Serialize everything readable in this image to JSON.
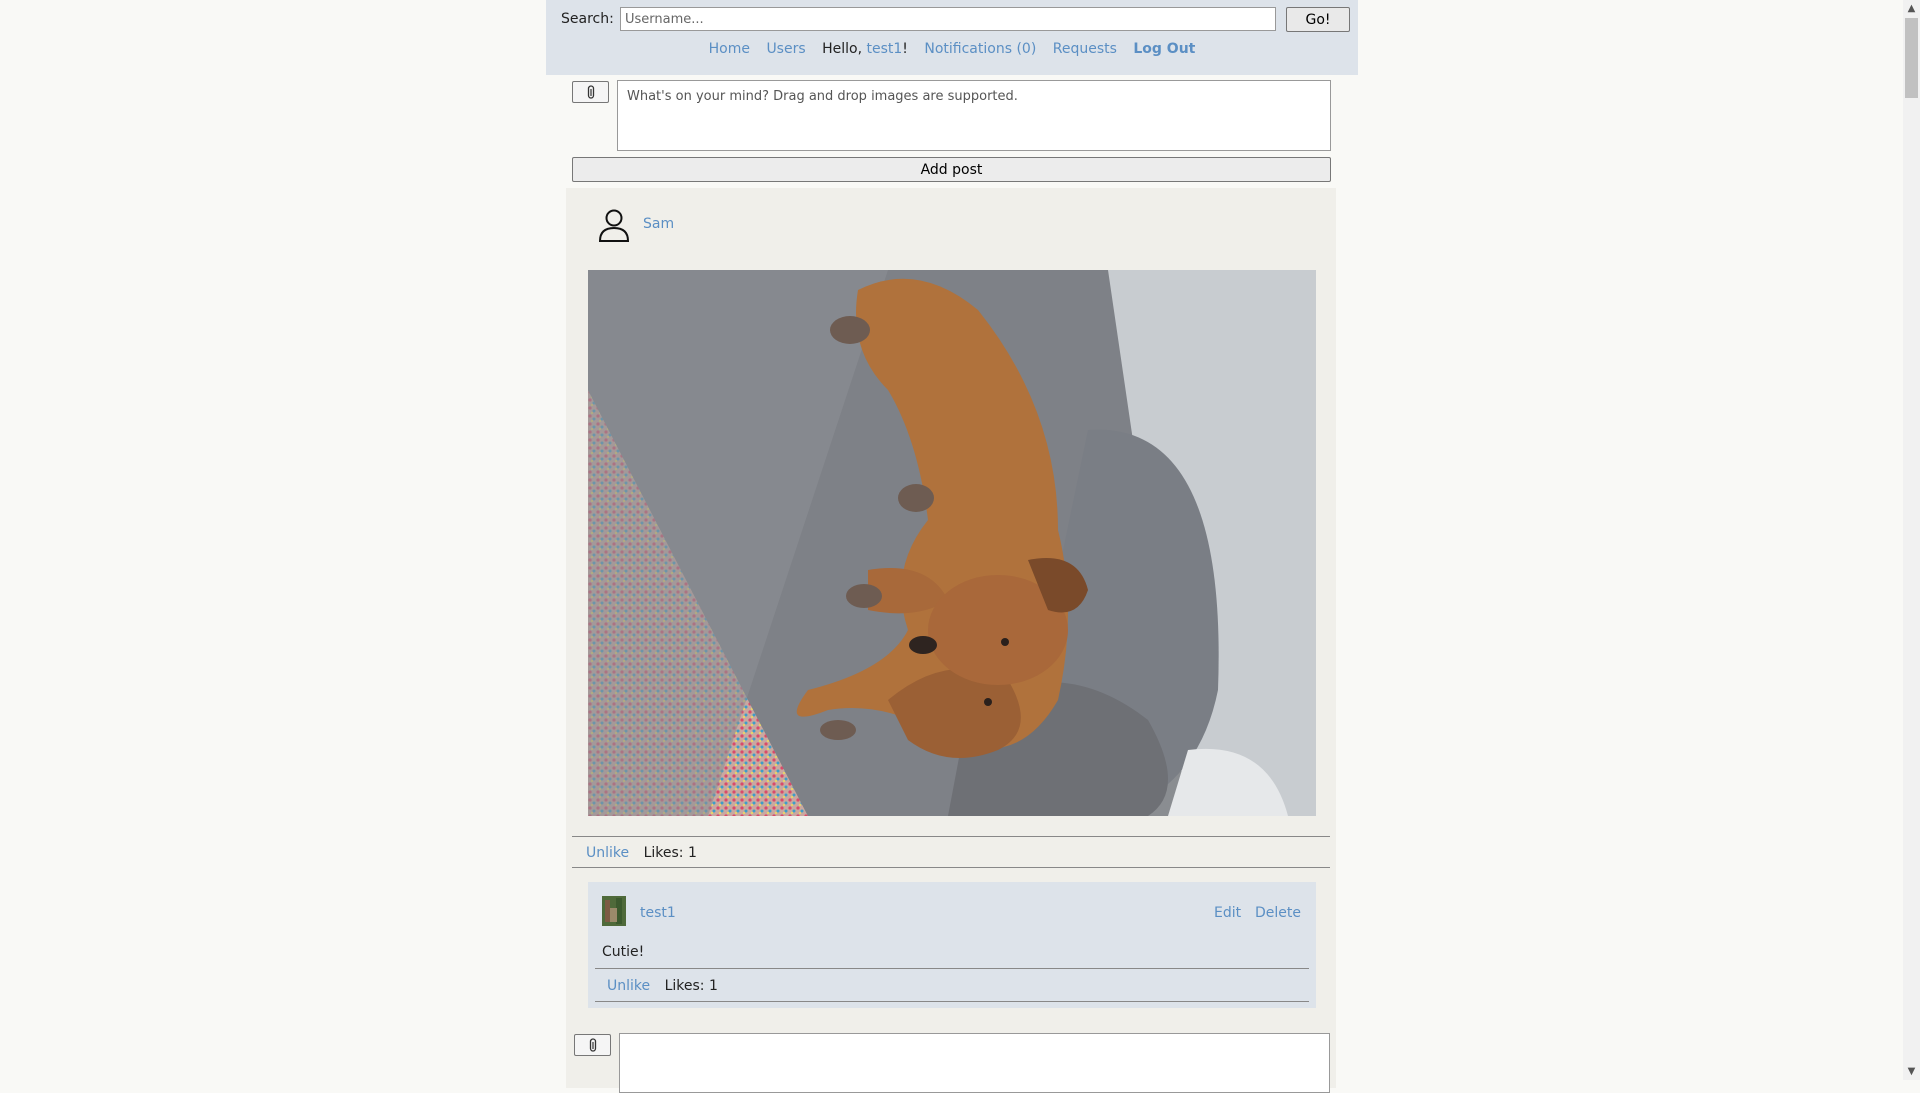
{
  "header": {
    "search_label": "Search:",
    "search_placeholder": "Username...",
    "go_label": "Go!",
    "nav": {
      "home": "Home",
      "users": "Users",
      "hello_prefix": "Hello,",
      "username": "test1",
      "hello_suffix": "!",
      "notifications": "Notifications (0)",
      "requests": "Requests",
      "logout": "Log Out"
    }
  },
  "composer": {
    "placeholder": "What's on your mind? Drag and drop images are supported.",
    "add_post_label": "Add post"
  },
  "post": {
    "author": "Sam",
    "like_action": "Unlike",
    "likes_text": "Likes: 1",
    "comments": [
      {
        "author": "test1",
        "edit_label": "Edit",
        "delete_label": "Delete",
        "text": "Cutie!",
        "like_action": "Unlike",
        "likes_text": "Likes: 1"
      }
    ]
  },
  "colors": {
    "link": "#5b8fc4",
    "header_bg": "#dde3ea",
    "page_bg": "#f9f9f6",
    "card_bg": "#f0efea",
    "comment_bg": "#dde3ea"
  },
  "icons": {
    "attach": "paperclip-icon",
    "author_avatar": "user-outline-icon"
  }
}
